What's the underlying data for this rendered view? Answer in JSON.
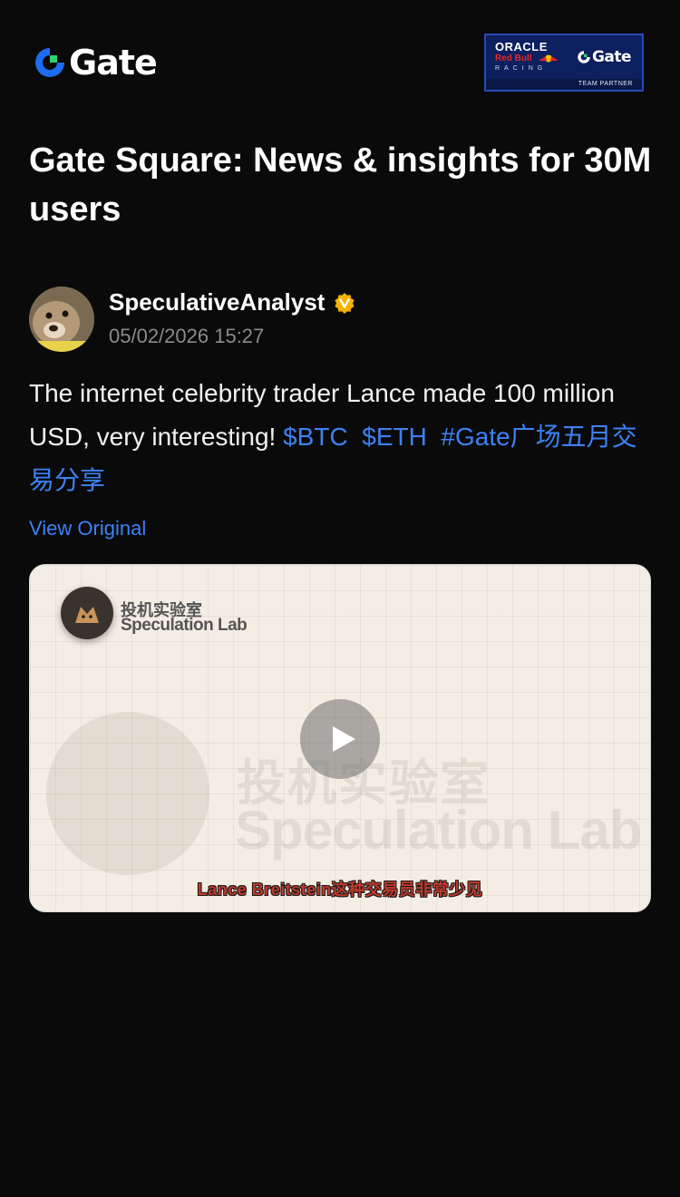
{
  "brand": {
    "name": "Gate",
    "accent_blue": "#1d6cf2",
    "accent_green": "#2dd36f"
  },
  "partner_badge": {
    "oracle": "ORACLE",
    "redbull": "Red Bull",
    "racing": "RACING",
    "gate": "Gate",
    "footer": "TEAM PARTNER"
  },
  "headline": "Gate Square: News & insights for 30M users",
  "post": {
    "author": "SpeculativeAnalyst",
    "timestamp": "05/02/2026 15:27",
    "text": "The internet celebrity trader Lance made 100 million USD, very interesting!",
    "tags": [
      "$BTC",
      "$ETH",
      "#Gate广场五月交易分享"
    ],
    "view_original": "View Original",
    "video": {
      "channel_cn": "投机实验室",
      "channel_en": "Speculation Lab",
      "watermark_cn": "投机实验室",
      "watermark_en": "Speculation Lab",
      "subtitle": "Lance Breitstein这种交易员非常少见"
    }
  },
  "colors": {
    "background": "#0a0a0a",
    "link": "#3b82f6",
    "verified": "#f5b301"
  }
}
